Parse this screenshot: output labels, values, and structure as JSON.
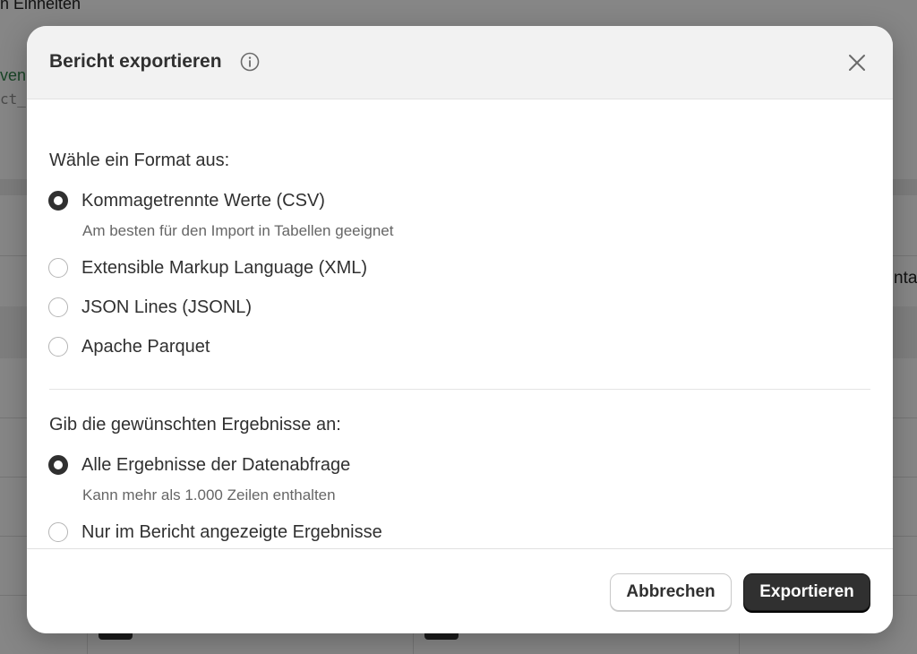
{
  "background": {
    "top_text": "n Einheiten",
    "side_text": "ven",
    "code_text": "ct_",
    "edge_text": "ntar"
  },
  "dialog": {
    "title": "Bericht exportieren",
    "info_icon": "info-icon",
    "close_icon": "close-icon"
  },
  "format_section": {
    "label": "Wähle ein Format aus:",
    "options": [
      {
        "label": "Kommagetrennte Werte (CSV)",
        "help": "Am besten für den Import in Tabellen geeignet",
        "checked": true
      },
      {
        "label": "Extensible Markup Language (XML)",
        "help": "",
        "checked": false
      },
      {
        "label": "JSON Lines (JSONL)",
        "help": "",
        "checked": false
      },
      {
        "label": "Apache Parquet",
        "help": "",
        "checked": false
      }
    ]
  },
  "results_section": {
    "label": "Gib die gewünschten Ergebnisse an:",
    "options": [
      {
        "label": "Alle Ergebnisse der Datenabfrage",
        "help": "Kann mehr als 1.000 Zeilen enthalten",
        "checked": true
      },
      {
        "label": "Nur im Bericht angezeigte Ergebnisse",
        "help": "",
        "checked": false
      }
    ]
  },
  "footer": {
    "cancel_label": "Abbrechen",
    "export_label": "Exportieren"
  },
  "colors": {
    "primary_button": "#303030",
    "header_bg": "#f2f2f2"
  }
}
